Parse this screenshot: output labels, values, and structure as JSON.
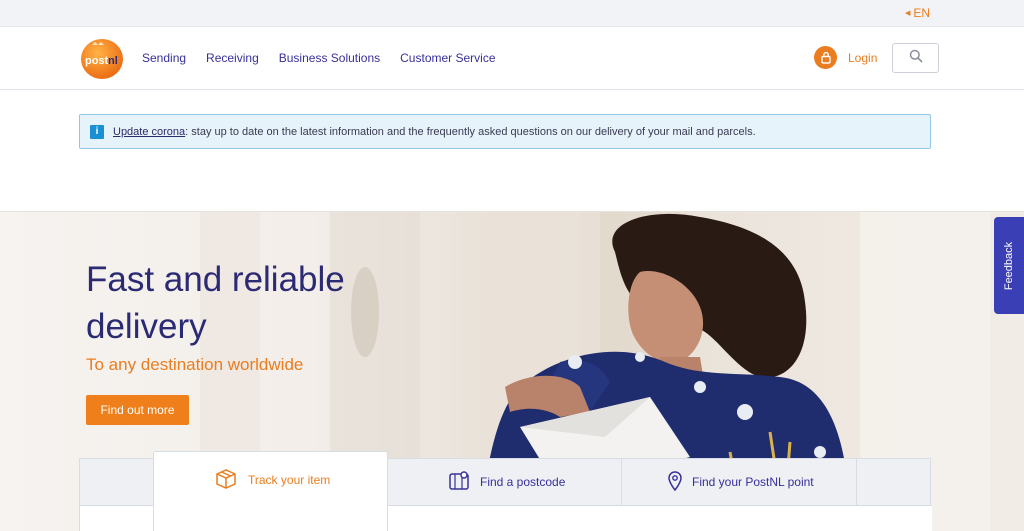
{
  "topbar": {
    "language": "EN"
  },
  "header": {
    "nav": [
      "Sending",
      "Receiving",
      "Business Solutions",
      "Customer Service"
    ],
    "login_label": "Login",
    "logo_text": "postnl"
  },
  "notice": {
    "link_text": "Update corona",
    "text": ": stay up to date on the latest information and the frequently asked questions on our delivery of your mail and parcels."
  },
  "hero": {
    "title": "Fast and reliable delivery",
    "subtitle": "To any destination worldwide",
    "button_label": "Find out more"
  },
  "feedback": {
    "label": "Feedback"
  },
  "tabs": [
    {
      "label": "Track your item",
      "icon": "package-icon",
      "active": true
    },
    {
      "label": "Find a postcode",
      "icon": "map-icon",
      "active": false
    },
    {
      "label": "Find your PostNL point",
      "icon": "location-pin-icon",
      "active": false
    }
  ],
  "colors": {
    "brand_orange": "#ef7f1a",
    "brand_navy": "#2b2a73",
    "nav_blue": "#38309a",
    "feedback_blue": "#3b3fb6",
    "info_blue": "#1b8fd4"
  }
}
